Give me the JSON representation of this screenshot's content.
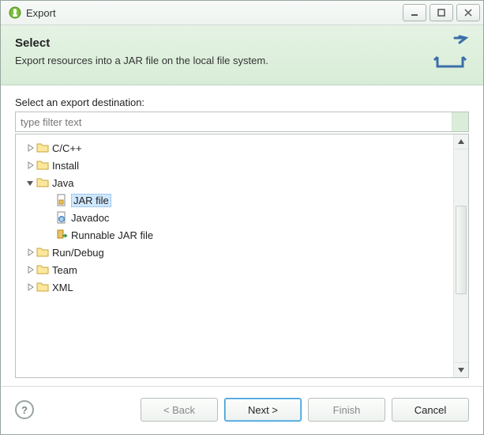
{
  "window": {
    "title": "Export"
  },
  "banner": {
    "title": "Select",
    "description": "Export resources into a JAR file on the local file system."
  },
  "body": {
    "label": "Select an export destination:",
    "filter_placeholder": "type filter text",
    "tree": [
      {
        "label": "C/C++",
        "expanded": false,
        "icon": "folder",
        "children": []
      },
      {
        "label": "Install",
        "expanded": false,
        "icon": "folder",
        "children": []
      },
      {
        "label": "Java",
        "expanded": true,
        "icon": "folder-open",
        "children": [
          {
            "label": "JAR file",
            "icon": "jar",
            "selected": true
          },
          {
            "label": "Javadoc",
            "icon": "javadoc",
            "selected": false
          },
          {
            "label": "Runnable JAR file",
            "icon": "runjar",
            "selected": false
          }
        ]
      },
      {
        "label": "Run/Debug",
        "expanded": false,
        "icon": "folder",
        "children": []
      },
      {
        "label": "Team",
        "expanded": false,
        "icon": "folder",
        "children": []
      },
      {
        "label": "XML",
        "expanded": false,
        "icon": "folder",
        "children": []
      }
    ]
  },
  "buttons": {
    "back": "< Back",
    "next": "Next >",
    "finish": "Finish",
    "cancel": "Cancel"
  }
}
